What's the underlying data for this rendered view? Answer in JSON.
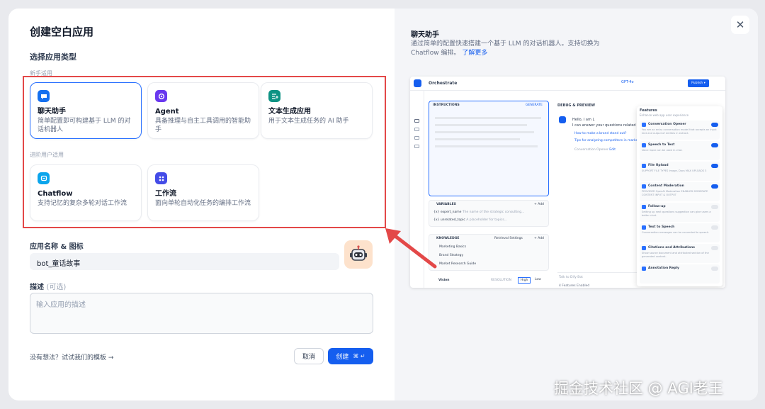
{
  "dialog": {
    "title": "创建空白应用",
    "section_title": "选择应用类型",
    "group_beginner": "新手适用",
    "group_advanced": "进阶用户适用",
    "types": [
      {
        "name": "聊天助手",
        "desc": "简单配置即可构建基于 LLM 的对话机器人",
        "icon": "chat-bubble-icon",
        "color": "#1570ef"
      },
      {
        "name": "Agent",
        "desc": "具备推理与自主工具调用的智能助手",
        "icon": "agent-icon",
        "color": "#6938ef"
      },
      {
        "name": "文本生成应用",
        "desc": "用于文本生成任务的 AI 助手",
        "icon": "text-generation-icon",
        "color": "#0e9384"
      },
      {
        "name": "Chatflow",
        "desc": "支持记忆的复杂多轮对话工作流",
        "icon": "chatflow-icon",
        "color": "#0ba5ec"
      },
      {
        "name": "工作流",
        "desc": "面向单轮自动化任务的编排工作流",
        "icon": "workflow-icon",
        "color": "#444ce7"
      }
    ],
    "name_label": "应用名称 & 图标",
    "name_value": "bot_童话故事",
    "desc_label": "描述",
    "desc_optional": "(可选)",
    "desc_placeholder": "输入应用的描述",
    "template_link": "没有想法？试试我们的模板 →",
    "cancel_label": "取消",
    "create_label": "创建",
    "create_shortcut": "⌘ ↵"
  },
  "preview": {
    "title": "聊天助手",
    "desc": "通过简单的配置快速搭建一个基于 LLM 的对话机器人。支持切换为 Chatflow 编排。",
    "learn_more": "了解更多",
    "screenshot": {
      "header": "Orchestrate",
      "model": "GPT-4o",
      "publish": "Publish ▾",
      "instructions": "INSTRUCTIONS",
      "generate": "GENERATE",
      "debug": "DEBUG & PREVIEW",
      "greeting_1": "Hello, I am L",
      "greeting_2": "I can answer your questions related",
      "suggest_1": "How to make a brand stand out?",
      "suggest_2": "Tips for analyzing competitors in market",
      "opener": "Conversation Opener",
      "opener_edit": "Edit",
      "variables": "VARIABLES",
      "add": "+ Add",
      "vars": [
        {
          "name": "{x} expert_name",
          "desc": "The name of the strategic consulting...",
          "type": "String (8)"
        },
        {
          "name": "{x} unrelated_topic",
          "desc": "A placeholder for topics...",
          "type": "String (8)"
        }
      ],
      "knowledge": "KNOWLEDGE",
      "retrieval": "Retrieval Settings",
      "docs": [
        {
          "name": "Marketing Basics",
          "tag": "HQ · HYBRID"
        },
        {
          "name": "Brand Strategy",
          "tag": "HQ · INVERTED"
        },
        {
          "name": "Market Research Guide",
          "tag": "HQ · HYBRID"
        }
      ],
      "vision": "Vision",
      "resolution": "RESOLUTION",
      "high": "High",
      "low": "Low",
      "talk_to": "Talk to Dify Bot",
      "features_enabled": "4 Features Enabled",
      "features_title": "Features",
      "features_sub": "Enhance web app user experience",
      "features": [
        {
          "name": "Conversation Opener",
          "desc": "You are an entry conversation model that accepts an input text and output of entities in extract.",
          "on": true
        },
        {
          "name": "Speech to Text",
          "desc": "Voice input can be used in chat.",
          "on": true
        },
        {
          "name": "File Upload",
          "desc": "SUPPORT FILE TYPES  Image, Docs      MAX UPLOADS  3",
          "on": true
        },
        {
          "name": "Content Moderation",
          "desc": "PROVIDER  OpenAI Moderation      ENABLED MODERATE CONTENT  INPUT & OUTPUT",
          "on": true
        },
        {
          "name": "Follow-up",
          "desc": "Setting up next questions suggestion can give users a better chat.",
          "on": false
        },
        {
          "name": "Text to Speech",
          "desc": "Conversation messages can be converted to speech.",
          "on": false
        },
        {
          "name": "Citations and Attributions",
          "desc": "Show source document and attributed section of the generated content.",
          "on": false
        },
        {
          "name": "Annotation Reply",
          "desc": "",
          "on": false
        }
      ]
    }
  },
  "watermark": "掘金技术社区 @ AGI老王"
}
